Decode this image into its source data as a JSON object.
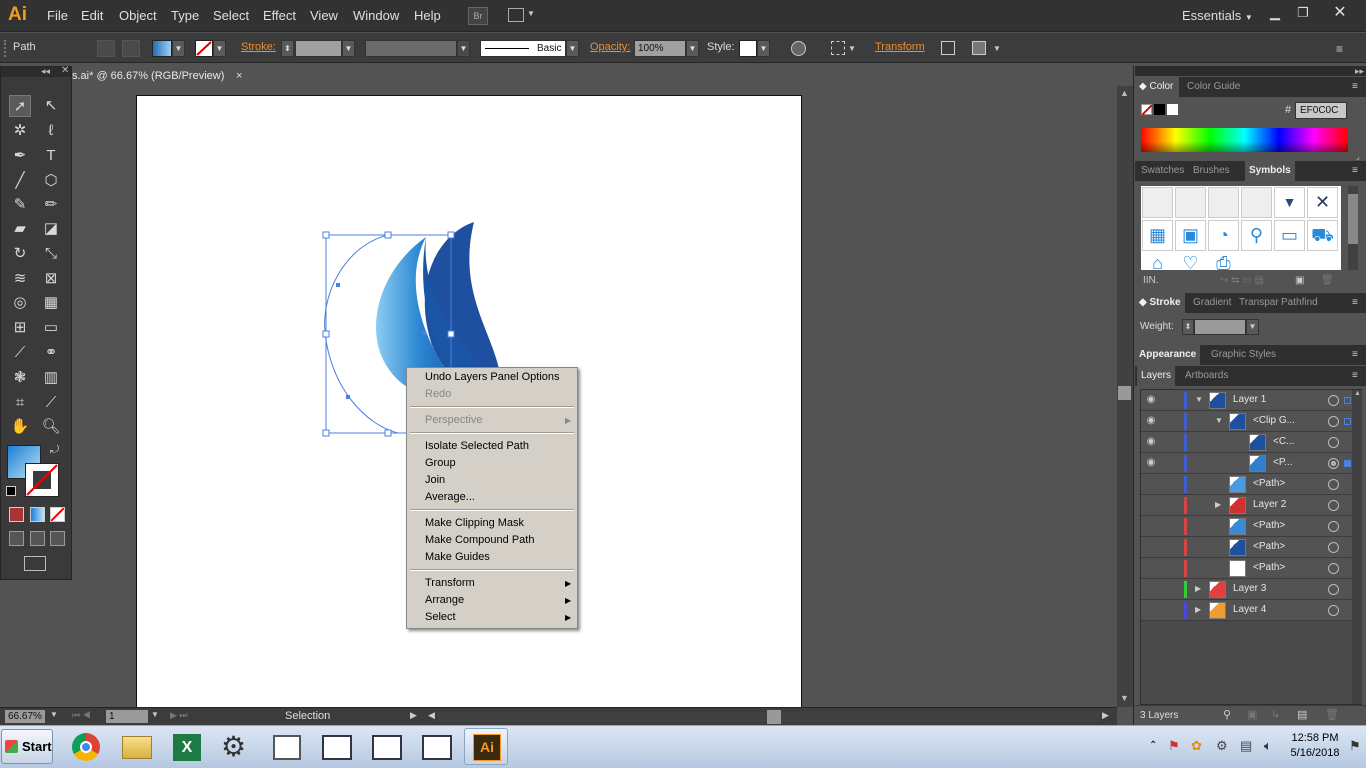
{
  "menubar": {
    "logo": "Ai",
    "menus": [
      "File",
      "Edit",
      "Object",
      "Type",
      "Select",
      "Effect",
      "View",
      "Window",
      "Help"
    ],
    "bridge": "Br",
    "workspace": "Essentials",
    "window_controls": [
      "minimize-icon",
      "restore-icon",
      "close-icon"
    ]
  },
  "control_bar": {
    "selection_type": "Path",
    "stroke_label": "Stroke:",
    "brush_label": "Basic",
    "opacity_label": "Opacity:",
    "opacity_value": "100%",
    "style_label": "Style:",
    "transform_label": "Transform"
  },
  "document": {
    "tab_title": "s.ai* @ 66.67% (RGB/Preview)",
    "close": "×",
    "zoom": "66.67%",
    "artboard_nav": "1",
    "status_text": "Selection"
  },
  "context_menu": {
    "items": [
      {
        "label": "Undo Layers Panel Options",
        "enabled": true
      },
      {
        "label": "Redo",
        "enabled": false
      },
      {
        "label": "Perspective",
        "enabled": false,
        "submenu": true
      },
      {
        "label": "Isolate Selected Path",
        "enabled": true
      },
      {
        "label": "Group",
        "enabled": true
      },
      {
        "label": "Join",
        "enabled": true
      },
      {
        "label": "Average...",
        "enabled": true
      },
      {
        "label": "Make Clipping Mask",
        "enabled": true
      },
      {
        "label": "Make Compound Path",
        "enabled": true
      },
      {
        "label": "Make Guides",
        "enabled": true
      },
      {
        "label": "Transform",
        "enabled": true,
        "submenu": true
      },
      {
        "label": "Arrange",
        "enabled": true,
        "submenu": true
      },
      {
        "label": "Select",
        "enabled": true,
        "submenu": true
      }
    ]
  },
  "color_panel": {
    "tabs": [
      "Color",
      "Color Guide"
    ],
    "hash": "#",
    "hex_value": "EF0C0C"
  },
  "symbols_panel": {
    "tabs": [
      "Swatches",
      "Brushes",
      "Symbols"
    ]
  },
  "stroke_panel": {
    "tabs": [
      "Stroke",
      "Gradient",
      "Transpar",
      "Pathfind"
    ],
    "weight_label": "Weight:"
  },
  "appearance_panel": {
    "tabs": [
      "Appearance",
      "Graphic Styles"
    ]
  },
  "layers_panel": {
    "tabs": [
      "Layers",
      "Artboards"
    ],
    "footer": "3 Layers",
    "rows": [
      {
        "name": "Layer 1",
        "visible": true,
        "bar": "#3f5fd1",
        "thumb": "#1f4f9f",
        "indent": 0,
        "expanded": true
      },
      {
        "name": "<Clip G...",
        "visible": true,
        "bar": "#3f5fd1",
        "thumb": "#1f4f9f",
        "indent": 1,
        "expanded": true
      },
      {
        "name": "<C...",
        "visible": true,
        "bar": "#3f5fd1",
        "thumb": "#1f4f9f",
        "indent": 2
      },
      {
        "name": "<P...",
        "visible": true,
        "bar": "#3f5fd1",
        "thumb": "#2f7fcf",
        "indent": 2
      },
      {
        "name": "<Path>",
        "visible": false,
        "bar": "#3f5fd1",
        "thumb": "#4a9ae0",
        "indent": 1
      },
      {
        "name": "Layer 2",
        "visible": false,
        "bar": "#d64545",
        "thumb": "#d03030",
        "indent": 1,
        "expanded": false
      },
      {
        "name": "<Path>",
        "visible": false,
        "bar": "#d64545",
        "thumb": "#3a8ad8",
        "indent": 1
      },
      {
        "name": "<Path>",
        "visible": false,
        "bar": "#d64545",
        "thumb": "#1f4f9f",
        "indent": 1
      },
      {
        "name": "<Path>",
        "visible": false,
        "bar": "#d64545",
        "thumb": "#ffffff",
        "indent": 1
      },
      {
        "name": "Layer 3",
        "visible": false,
        "bar": "#33cc33",
        "thumb": "#e04040",
        "indent": 0,
        "expanded": false
      },
      {
        "name": "Layer 4",
        "visible": false,
        "bar": "#4a4ad8",
        "thumb": "#f29b2e",
        "indent": 0,
        "expanded": false
      }
    ]
  },
  "taskbar": {
    "start": "Start",
    "apps": [
      "chrome-icon",
      "folder-icon",
      "excel-icon",
      "gears-icon",
      "window-icon",
      "window-icon",
      "window-icon",
      "window-icon",
      "illustrator-icon"
    ],
    "time": "12:58 PM",
    "date": "5/16/2018"
  },
  "colors": {
    "accent_orange": "#f08d2c",
    "selection_blue": "#4b7fe0",
    "logo_dark_blue": "#1f4f9f",
    "logo_light_blue": "#4aa3e0"
  }
}
